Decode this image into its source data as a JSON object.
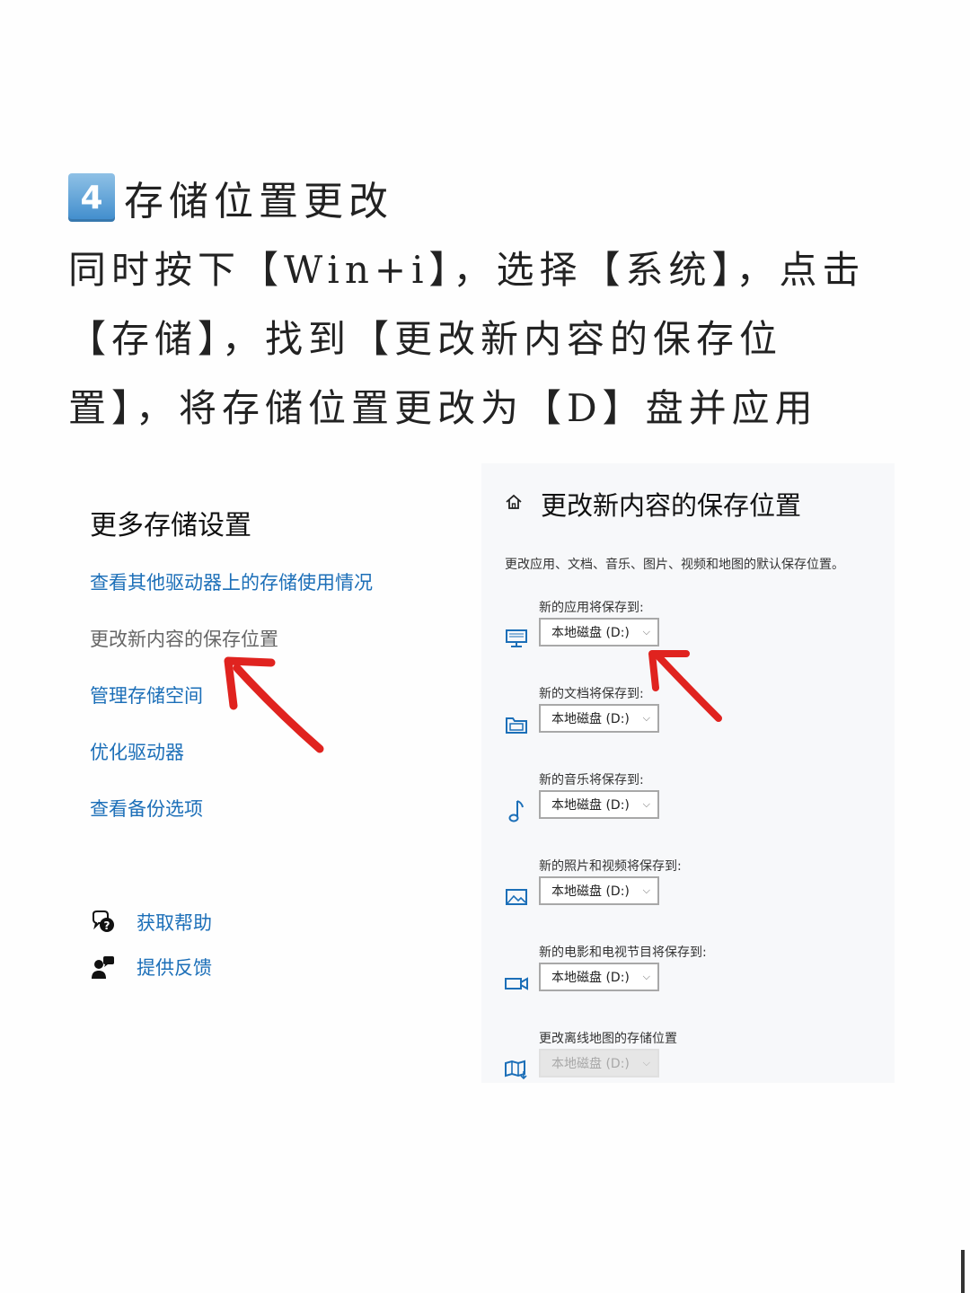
{
  "header": {
    "step_number": "4",
    "title": "存储位置更改",
    "instruction_lines": [
      "同时按下【Win+i】，选择【系统】，点击",
      "【存储】，找到【更改新内容的保存位",
      "置】，将存储位置更改为【D】盘并应用"
    ]
  },
  "left_panel": {
    "heading": "更多存储设置",
    "links": [
      "查看其他驱动器上的存储使用情况",
      "更改新内容的保存位置",
      "管理存储空间",
      "优化驱动器",
      "查看备份选项"
    ],
    "help": "获取帮助",
    "feedback": "提供反馈"
  },
  "right_panel": {
    "title": "更改新内容的保存位置",
    "description": "更改应用、文档、音乐、图片、视频和地图的默认保存位置。",
    "items": [
      {
        "label": "新的应用将保存到:",
        "value": "本地磁盘 (D:)",
        "icon": "monitor-icon"
      },
      {
        "label": "新的文档将保存到:",
        "value": "本地磁盘 (D:)",
        "icon": "folder-icon"
      },
      {
        "label": "新的音乐将保存到:",
        "value": "本地磁盘 (D:)",
        "icon": "music-note-icon"
      },
      {
        "label": "新的照片和视频将保存到:",
        "value": "本地磁盘 (D:)",
        "icon": "picture-icon"
      },
      {
        "label": "新的电影和电视节目将保存到:",
        "value": "本地磁盘 (D:)",
        "icon": "video-camera-icon"
      },
      {
        "label": "更改离线地图的存储位置",
        "value": "本地磁盘 (D:)",
        "icon": "map-icon"
      }
    ]
  },
  "colors": {
    "link": "#1c6fb8",
    "arrow": "#e0231f",
    "badge": "#3f8ccc"
  }
}
